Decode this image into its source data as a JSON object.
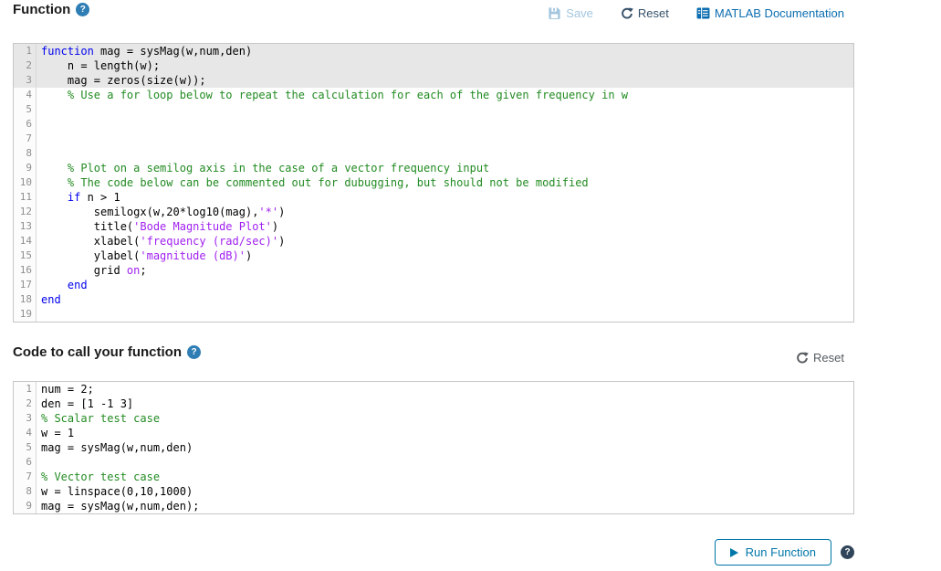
{
  "header": {
    "title": "Function",
    "help_glyph": "?"
  },
  "toolbar": {
    "save": "Save",
    "reset": "Reset",
    "docs": "MATLAB Documentation"
  },
  "section2": {
    "title": "Code to call your function",
    "help_glyph": "?",
    "reset": "Reset"
  },
  "footer": {
    "run": "Run Function",
    "help_glyph": "?"
  },
  "colors": {
    "accent": "#0076a8",
    "keyword": "#0000ee",
    "comment": "#228b22",
    "string": "#a020f0",
    "selection_highlight": "#e7e7e7",
    "save_disabled": "#a3c6de",
    "docs_link": "#0b6db0",
    "reset_top": "#35506a",
    "reset_bottom": "#555b60"
  },
  "editors": [
    {
      "name": "function-editor",
      "highlighted_lines": [
        1,
        2,
        3
      ],
      "lines": [
        [
          {
            "t": "function",
            "c": "keyword"
          },
          {
            "t": " mag = sysMag(w,num,den)",
            "c": "plain"
          }
        ],
        [
          {
            "t": "    n = length(w);",
            "c": "plain"
          }
        ],
        [
          {
            "t": "    mag = zeros(size(w));",
            "c": "plain"
          }
        ],
        [
          {
            "t": "    % Use a for loop below to repeat the calculation for each of the given frequency in w",
            "c": "comment"
          }
        ],
        [],
        [],
        [],
        [],
        [
          {
            "t": "    % Plot on a semilog axis in the case of a vector frequency input",
            "c": "comment"
          }
        ],
        [
          {
            "t": "    % The code below can be commented out for dubugging, but should not be modified",
            "c": "comment"
          }
        ],
        [
          {
            "t": "    ",
            "c": "plain"
          },
          {
            "t": "if",
            "c": "keyword"
          },
          {
            "t": " n > 1",
            "c": "plain"
          }
        ],
        [
          {
            "t": "        semilogx(w,20*log10(mag),",
            "c": "plain"
          },
          {
            "t": "'*'",
            "c": "string"
          },
          {
            "t": ")",
            "c": "plain"
          }
        ],
        [
          {
            "t": "        title(",
            "c": "plain"
          },
          {
            "t": "'Bode Magnitude Plot'",
            "c": "string"
          },
          {
            "t": ")",
            "c": "plain"
          }
        ],
        [
          {
            "t": "        xlabel(",
            "c": "plain"
          },
          {
            "t": "'frequency (rad/sec)'",
            "c": "string"
          },
          {
            "t": ")",
            "c": "plain"
          }
        ],
        [
          {
            "t": "        ylabel(",
            "c": "plain"
          },
          {
            "t": "'magnitude (dB)'",
            "c": "string"
          },
          {
            "t": ")",
            "c": "plain"
          }
        ],
        [
          {
            "t": "        grid ",
            "c": "plain"
          },
          {
            "t": "on",
            "c": "string"
          },
          {
            "t": ";",
            "c": "plain"
          }
        ],
        [
          {
            "t": "    ",
            "c": "plain"
          },
          {
            "t": "end",
            "c": "keyword"
          }
        ],
        [
          {
            "t": "end",
            "c": "keyword"
          }
        ],
        []
      ]
    },
    {
      "name": "call-code-editor",
      "highlighted_lines": [],
      "lines": [
        [
          {
            "t": "num = 2;",
            "c": "plain"
          }
        ],
        [
          {
            "t": "den = [1 -1 3]",
            "c": "plain"
          }
        ],
        [
          {
            "t": "% Scalar test case",
            "c": "comment"
          }
        ],
        [
          {
            "t": "w = 1",
            "c": "plain"
          }
        ],
        [
          {
            "t": "mag = sysMag(w,num,den)",
            "c": "plain"
          }
        ],
        [],
        [
          {
            "t": "% Vector test case",
            "c": "comment"
          }
        ],
        [
          {
            "t": "w = linspace(0,10,1000)",
            "c": "plain"
          }
        ],
        [
          {
            "t": "mag = sysMag(w,num,den);",
            "c": "plain"
          }
        ]
      ]
    }
  ]
}
